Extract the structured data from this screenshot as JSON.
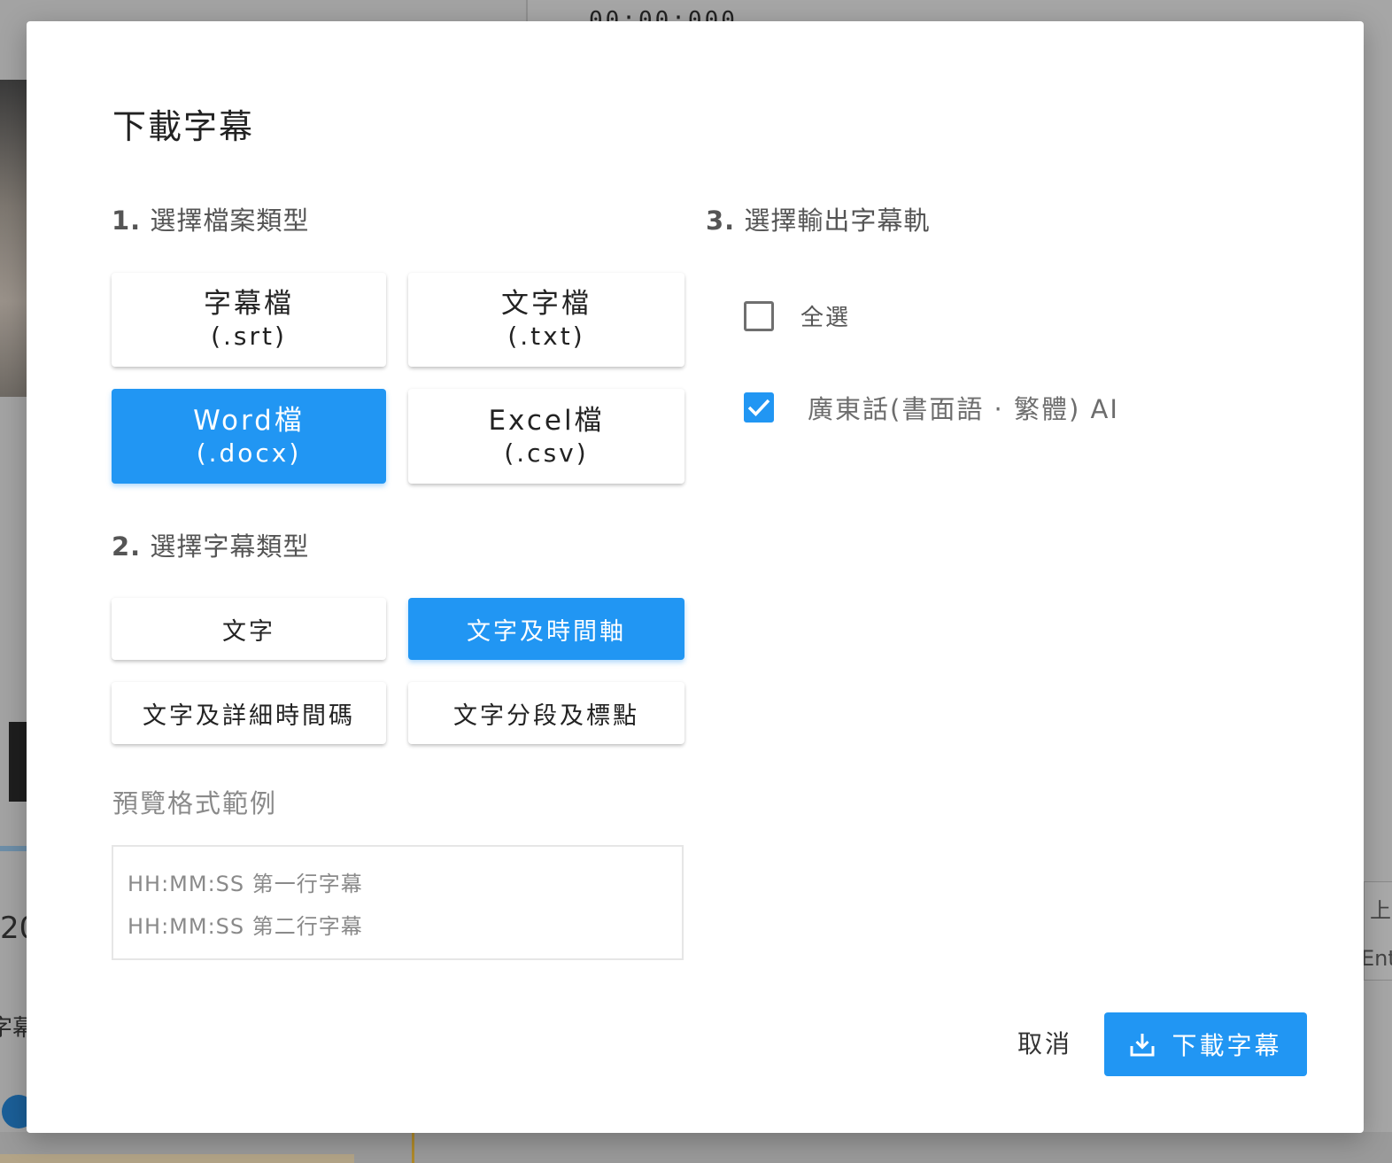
{
  "background": {
    "timecode": "00:00:000",
    "left_number": "20",
    "left_caption": "字幕",
    "right_text_1": "上",
    "right_text_2": "Ent"
  },
  "dialog": {
    "title": "下載字幕",
    "section1": {
      "num": "1.",
      "title": "選擇檔案類型"
    },
    "file_types": [
      {
        "line1": "字幕檔",
        "line2": "(.srt)",
        "selected": false
      },
      {
        "line1": "文字檔",
        "line2": "(.txt)",
        "selected": false
      },
      {
        "line1": "Word檔",
        "line2": "(.docx)",
        "selected": true
      },
      {
        "line1": "Excel檔",
        "line2": "(.csv)",
        "selected": false
      }
    ],
    "section2": {
      "num": "2.",
      "title": "選擇字幕類型"
    },
    "subtitle_types": [
      {
        "label": "文字",
        "selected": false
      },
      {
        "label": "文字及時間軸",
        "selected": true
      },
      {
        "label": "文字及詳細時間碼",
        "selected": false
      },
      {
        "label": "文字分段及標點",
        "selected": false
      }
    ],
    "preview": {
      "label": "預覽格式範例",
      "lines": [
        "HH:MM:SS 第一行字幕",
        "HH:MM:SS 第二行字幕"
      ]
    },
    "section3": {
      "num": "3.",
      "title": "選擇輸出字幕軌"
    },
    "tracks": {
      "select_all": {
        "label": "全選",
        "checked": false
      },
      "items": [
        {
          "label": "廣東話(書面語 · 繁體)  AI",
          "checked": true
        }
      ]
    },
    "footer": {
      "cancel_label": "取消",
      "download_label": "下載字幕",
      "download_icon": "download-icon"
    }
  },
  "colors": {
    "accent": "#2196f3",
    "overlay": "#a6a6a6"
  }
}
